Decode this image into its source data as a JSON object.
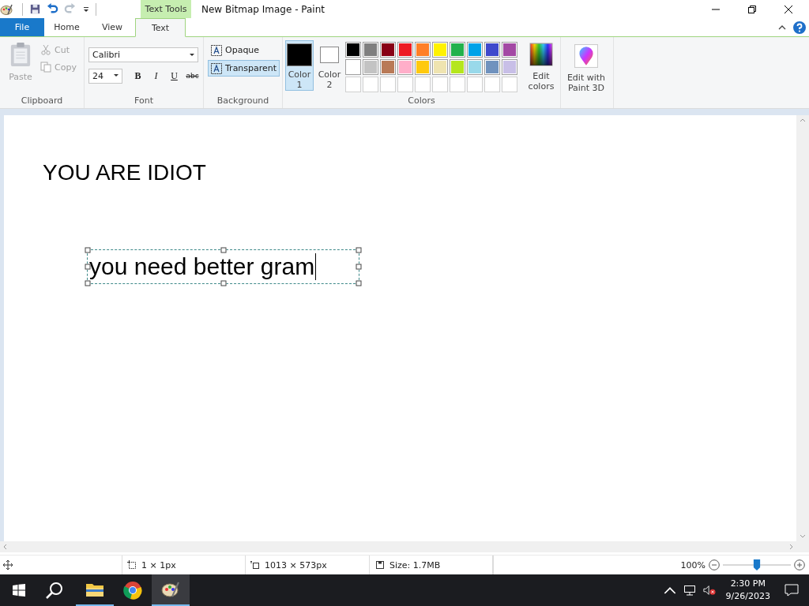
{
  "window": {
    "title": "New Bitmap Image - Paint",
    "contextual_tab": "Text Tools"
  },
  "tabs": [
    {
      "label": "File",
      "kind": "file",
      "selected": false
    },
    {
      "label": "Home",
      "kind": "tab",
      "selected": false
    },
    {
      "label": "View",
      "kind": "tab",
      "selected": false
    },
    {
      "label": "Text",
      "kind": "tab",
      "selected": true
    }
  ],
  "clipboard": {
    "label": "Clipboard",
    "paste": {
      "label": "Paste",
      "disabled": true
    },
    "cut": {
      "label": "Cut",
      "disabled": true
    },
    "copy": {
      "label": "Copy",
      "disabled": true
    }
  },
  "font": {
    "label": "Font",
    "family": "Calibri",
    "size": "24",
    "styles": [
      {
        "label": "B",
        "kind": "bold"
      },
      {
        "label": "I",
        "kind": "italic"
      },
      {
        "label": "U",
        "kind": "underline"
      },
      {
        "label": "abc",
        "kind": "strike"
      }
    ]
  },
  "background": {
    "label": "Background",
    "options": [
      {
        "label": "Opaque",
        "selected": false
      },
      {
        "label": "Transparent",
        "selected": true
      }
    ]
  },
  "colors": {
    "label": "Colors",
    "current": [
      {
        "label": "Color 1",
        "color": "#000000",
        "selected": true
      },
      {
        "label": "Color 2",
        "color": "#ffffff",
        "selected": false
      }
    ],
    "palette": [
      {
        "color": "#000000"
      },
      {
        "color": "#7f7f7f"
      },
      {
        "color": "#880015"
      },
      {
        "color": "#ed1c24"
      },
      {
        "color": "#ff7f27"
      },
      {
        "color": "#fff200"
      },
      {
        "color": "#22b14c"
      },
      {
        "color": "#00a2e8"
      },
      {
        "color": "#3f48cc"
      },
      {
        "color": "#a349a4"
      },
      {
        "color": "#ffffff"
      },
      {
        "color": "#c3c3c3"
      },
      {
        "color": "#b97a57"
      },
      {
        "color": "#ffaec9"
      },
      {
        "color": "#ffc90e"
      },
      {
        "color": "#efe4b0"
      },
      {
        "color": "#b5e61d"
      },
      {
        "color": "#99d9ea"
      },
      {
        "color": "#7092be"
      },
      {
        "color": "#c8bfe7"
      }
    ],
    "edit_label": "Edit colors"
  },
  "paint3d": {
    "label": "Edit with Paint 3D"
  },
  "canvas": {
    "texts": [
      {
        "text": "YOU ARE IDIOT",
        "editing": false
      },
      {
        "text": "you need better gram",
        "editing": true
      }
    ]
  },
  "status_bar": {
    "selection": "1 × 1px",
    "canvas_size": "1013 × 573px",
    "file_size": "Size: 1.7MB",
    "zoom": "100%",
    "zoom_level": {
      "level": 0.5
    }
  },
  "taskbar": {
    "time": "2:30 PM",
    "date": "9/26/2023"
  }
}
